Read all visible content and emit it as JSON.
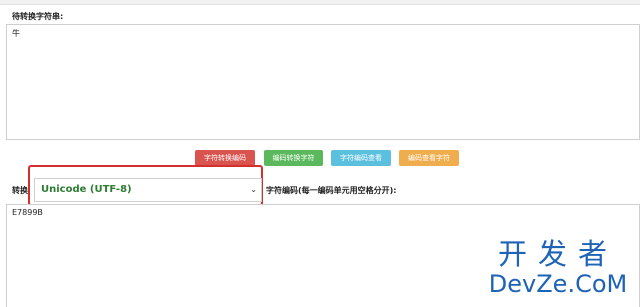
{
  "input_section": {
    "label": "待转换字符串:",
    "value": "牛"
  },
  "buttons": {
    "char_to_code": "字符转换编码",
    "code_to_char": "编码转换字符",
    "view_char_code": "字符编码查看",
    "view_code_char": "编码查看字符"
  },
  "output_section": {
    "label_prefix": "转换",
    "encoding_selected": "Unicode (UTF-8)",
    "label_suffix": "字符编码(每一编码单元用空格分开):",
    "value": "E7899B"
  },
  "watermark": {
    "line1": "开发者",
    "line2": "DevZe.CoM"
  },
  "colors": {
    "accent_red": "#d9534f",
    "accent_green": "#5cb85c",
    "accent_blue": "#5bc0de",
    "accent_orange": "#f0ad4e",
    "highlight": "#d32f2f",
    "watermark": "#1e63b6"
  }
}
